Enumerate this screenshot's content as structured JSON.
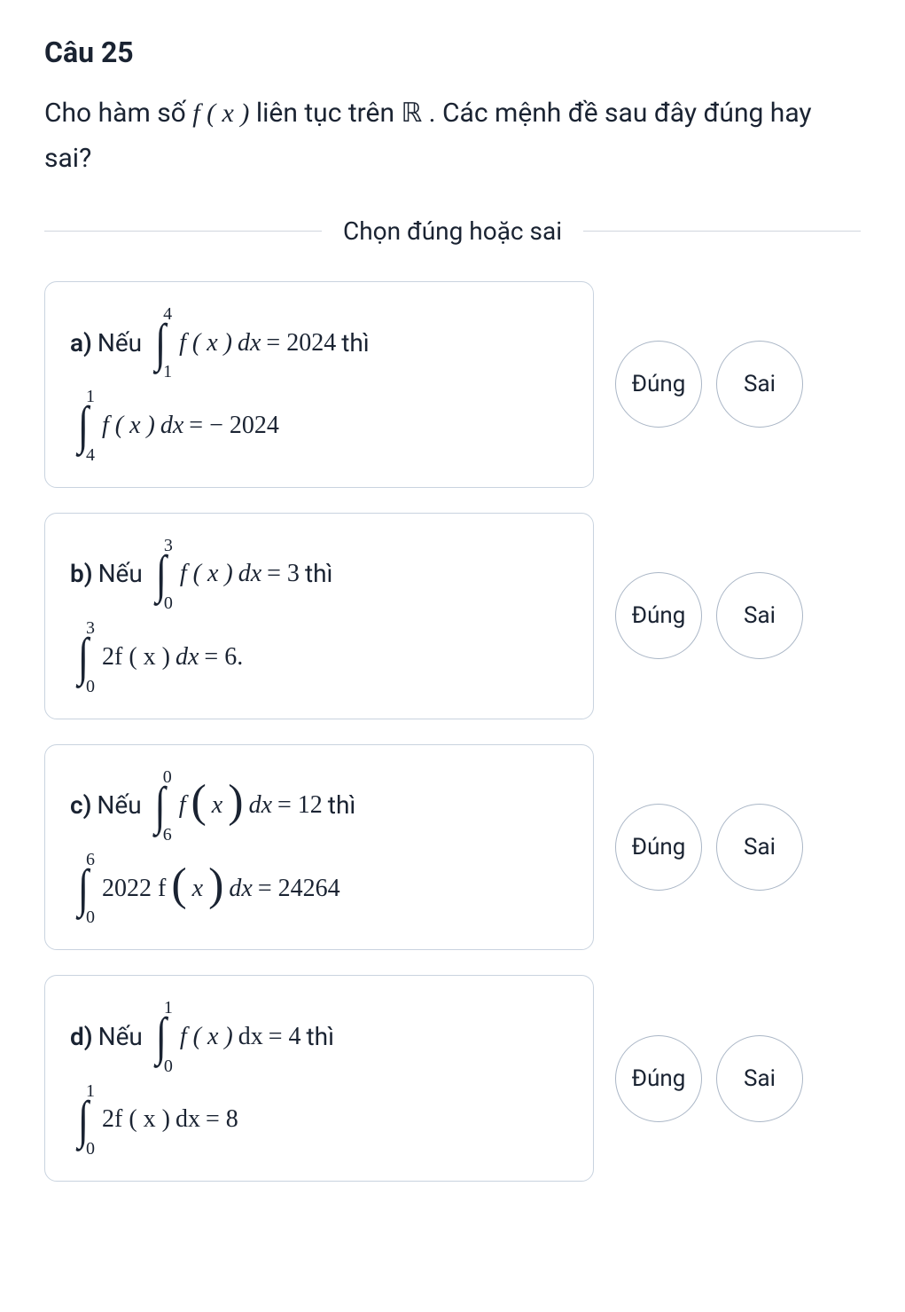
{
  "question": {
    "number": "Câu 25",
    "text_parts": {
      "p1": "Cho hàm số ",
      "fx": "f ( x )",
      "p2": " liên tục trên ",
      "R": "ℝ",
      "p3": ". Các mệnh đề sau đây đúng hay sai?"
    }
  },
  "divider": "Chọn đúng hoặc sai",
  "buttons": {
    "true": "Đúng",
    "false": "Sai"
  },
  "options": [
    {
      "id": "a",
      "label": "a)",
      "prefix": "Nếu ",
      "int1": {
        "top": "4",
        "bot": "1",
        "body_pre": "f ( x ) ",
        "dx": "dx",
        "eq": " = 2024",
        "suffix": " thì"
      },
      "int2": {
        "top": "1",
        "bot": "4",
        "body_pre": "f ( x ) ",
        "dx": "dx",
        "eq": " = − 2024",
        "suffix": ""
      }
    },
    {
      "id": "b",
      "label": "b)",
      "prefix": "Nếu ",
      "int1": {
        "top": "3",
        "bot": "0",
        "body_pre": "f ( x ) ",
        "dx": "dx",
        "eq": " = 3",
        "suffix": " thì"
      },
      "int2": {
        "top": "3",
        "bot": "0",
        "body_pre": "2f ( x ) ",
        "dx": "dx",
        "eq": " = 6.",
        "suffix": ""
      }
    },
    {
      "id": "c",
      "label": "c)",
      "prefix": "Nếu ",
      "int1": {
        "top": "0",
        "bot": "6",
        "body_pre": "f ",
        "bigparen": true,
        "arg": "x",
        "dx": " dx",
        "eq": " = 12",
        "suffix": " thì"
      },
      "int2": {
        "top": "6",
        "bot": "0",
        "body_pre": "2022 f ",
        "bigparen": true,
        "arg": "x",
        "dx": " dx",
        "eq": " = 24264",
        "suffix": ""
      }
    },
    {
      "id": "d",
      "label": "d)",
      "prefix": "Nếu ",
      "int1": {
        "top": "1",
        "bot": "0",
        "body_pre": "f ( x ) ",
        "dx": "dx",
        "eq": " = 4",
        "suffix": " thì"
      },
      "int2": {
        "top": "1",
        "bot": "0",
        "body_pre": "2f ( x ) ",
        "dx": "dx",
        "eq": " = 8",
        "suffix": ""
      }
    }
  ]
}
